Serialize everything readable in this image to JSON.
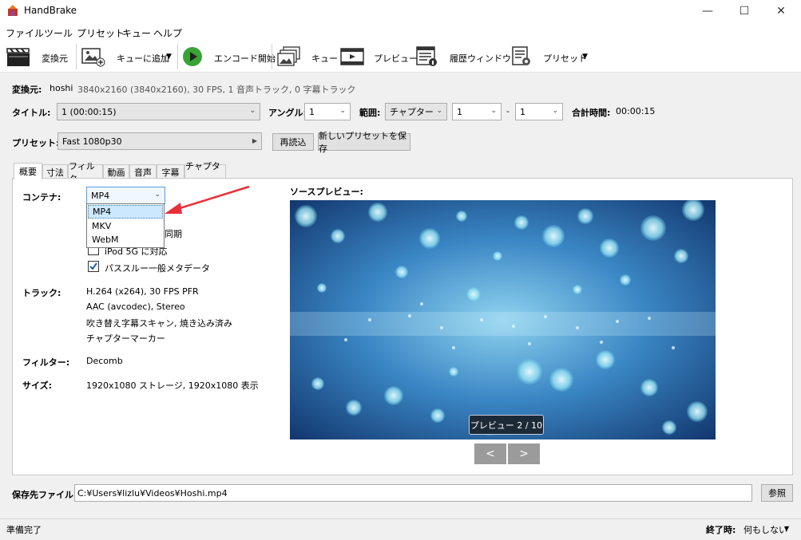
{
  "window": {
    "title": "HandBrake"
  },
  "menu": [
    "ファイル",
    "ツール",
    "プリセット",
    "キュー",
    "ヘルプ"
  ],
  "toolbar": {
    "source": "変換元",
    "add_to_queue": "キューに追加",
    "start_encode": "エンコード開始",
    "queue": "キュー",
    "preview": "プレビュー",
    "activity_log": "履歴ウィンドウ",
    "presets": "プリセット"
  },
  "source": {
    "label": "変換元:",
    "name": "hoshi",
    "info": "3840x2160 (3840x2160), 30 FPS, 1 音声トラック, 0 字幕トラック"
  },
  "title_row": {
    "title_label": "タイトル:",
    "title_value": "1  (00:00:15)",
    "angle_label": "アングル:",
    "angle_value": "1",
    "range_label": "範囲:",
    "range_type": "チャプター",
    "range_start": "1",
    "range_sep": "-",
    "range_end": "1",
    "duration_label": "合計時間:",
    "duration_value": "00:00:15"
  },
  "preset_row": {
    "label": "プリセット:",
    "value": "Fast 1080p30",
    "reload": "再読込",
    "save_new": "新しいプリセットを保存"
  },
  "tabs": [
    "概要",
    "寸法",
    "フィルタ",
    "動画",
    "音声",
    "字幕",
    "チャプター"
  ],
  "summary": {
    "container_label": "コンテナ:",
    "container_value": "MP4",
    "container_options": [
      "MP4",
      "MKV",
      "WebM"
    ],
    "align_av_suffix": "同期",
    "ipod_label": "iPod 5G に対応",
    "passthru_label": "パススルー一般メタデータ",
    "tracks_label": "トラック:",
    "tracks": [
      "H.264 (x264), 30 FPS PFR",
      "AAC (avcodec), Stereo",
      "吹き替え字幕スキャン, 焼き込み済み",
      "チャプターマーカー"
    ],
    "filters_label": "フィルター:",
    "filters_value": "Decomb",
    "size_label": "サイズ:",
    "size_value": "1920x1080 ストレージ, 1920x1080 表示"
  },
  "preview": {
    "label": "ソースプレビュー:",
    "counter": "プレビュー 2 / 10",
    "prev": "<",
    "next": ">"
  },
  "destination": {
    "label": "保存先ファイル:",
    "path": "C:¥Users¥lizlu¥Videos¥Hoshi.mp4",
    "browse": "参照"
  },
  "status": {
    "text": "準備完了",
    "when_done_label": "終了時:",
    "when_done_value": "何もしない"
  },
  "colors": {
    "accent_arrow": "#e8303a",
    "dropdown_highlight": "#cce8ff",
    "play_green": "#3aa335"
  }
}
